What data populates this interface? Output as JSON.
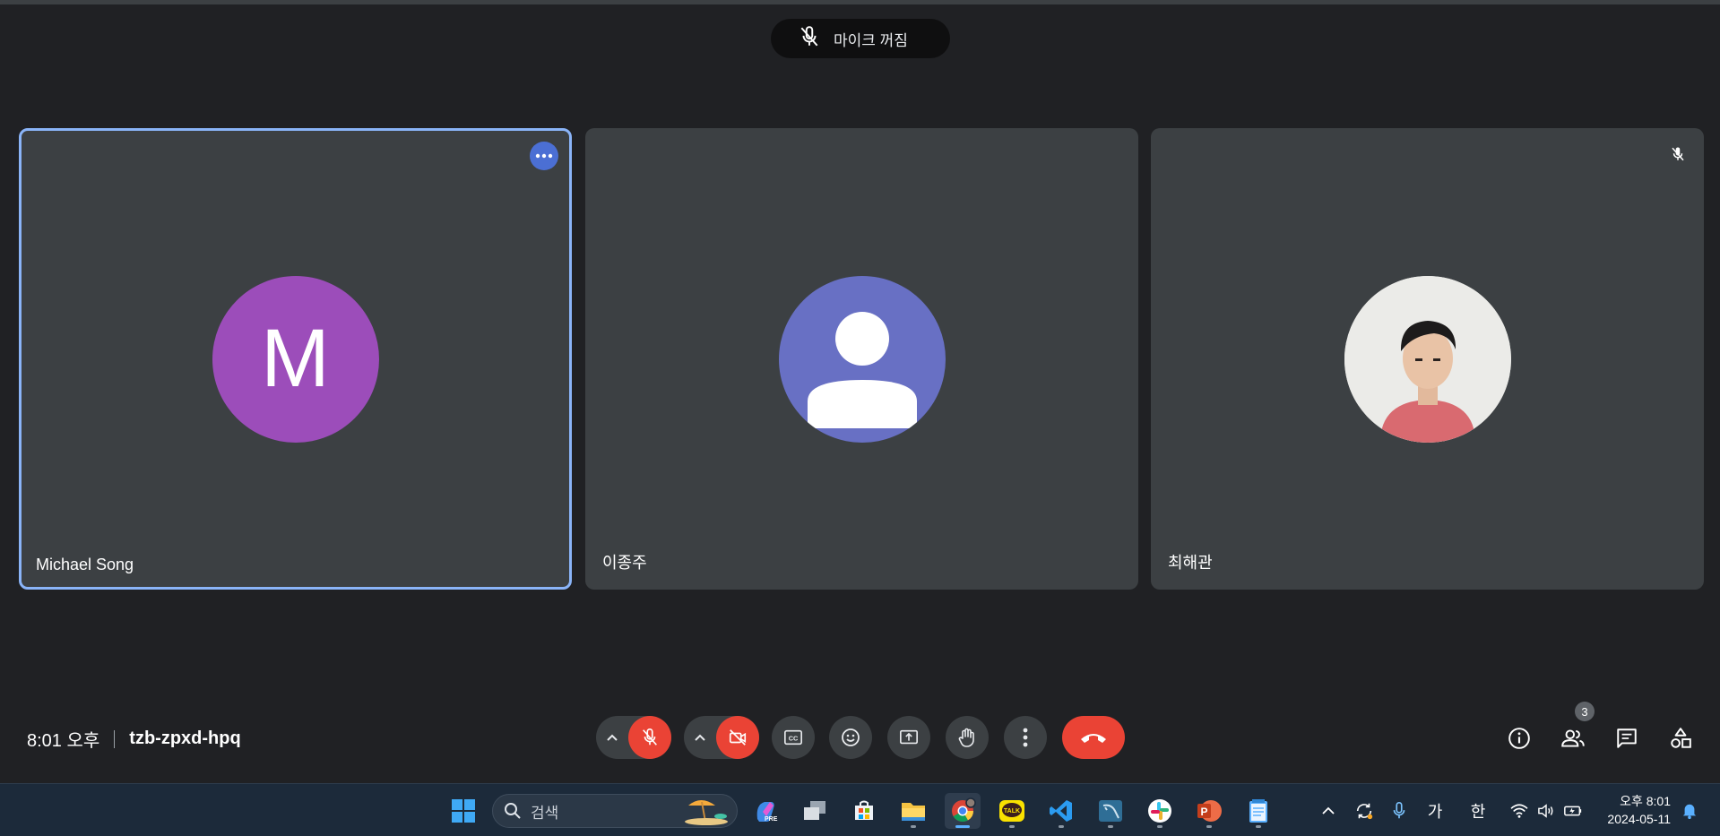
{
  "toast": {
    "text": "마이크 꺼짐",
    "icon": "mic-off-icon"
  },
  "participants": [
    {
      "name": "Michael Song",
      "avatar_type": "letter",
      "avatar_letter": "M",
      "avatar_color": "#9c4dba",
      "pinned_highlight": true
    },
    {
      "name": "이종주",
      "avatar_type": "default",
      "avatar_color": "#6870c4"
    },
    {
      "name": "최해관",
      "avatar_type": "photo",
      "muted": true
    }
  ],
  "meeting": {
    "time": "8:01 오후",
    "code": "tzb-zpxd-hpq"
  },
  "controls": {
    "mic_state": "off",
    "camera_state": "off",
    "buttons": [
      "mic-options",
      "microphone",
      "camera-options",
      "camera",
      "captions",
      "reactions",
      "present",
      "raise-hand",
      "more-options",
      "leave-call"
    ]
  },
  "right_controls": {
    "people_count": "3",
    "buttons": [
      "meeting-details",
      "people",
      "chat",
      "activities"
    ]
  },
  "taskbar": {
    "search_placeholder": "검색",
    "apps": [
      "windows-start",
      "copilot",
      "task-view",
      "microsoft-store",
      "file-explorer",
      "chrome",
      "kakaotalk",
      "vscode",
      "mysql-workbench",
      "slack",
      "powerpoint",
      "notepad"
    ],
    "active_app": "chrome",
    "tray_ime_1": "가",
    "tray_ime_2": "한",
    "clock_time": "오후 8:01",
    "clock_date": "2024-05-11"
  },
  "colors": {
    "background": "#202124",
    "tile": "#3c4043",
    "accent": "#8ab4f8",
    "danger": "#ea4335"
  }
}
